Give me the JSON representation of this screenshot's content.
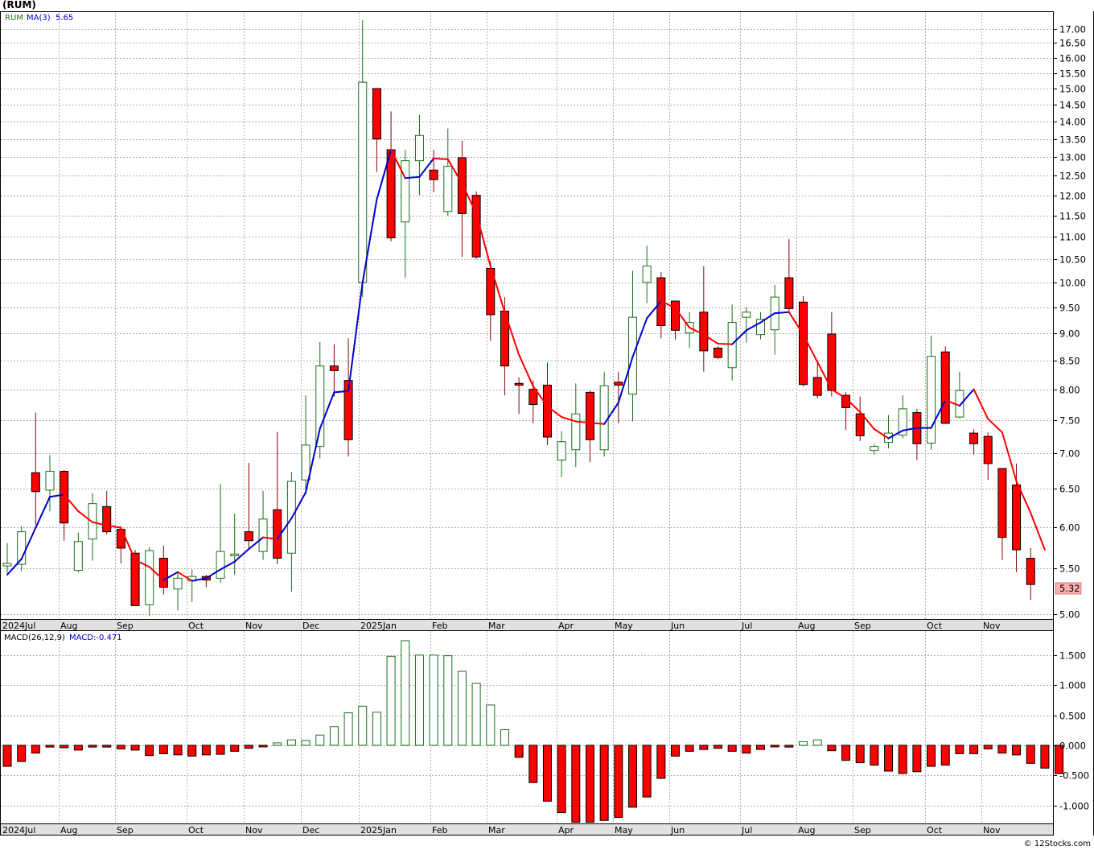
{
  "header": {
    "symbol_title": "(RUM)",
    "legend_symbol": "RUM",
    "legend_ma_label": "MA(3)",
    "legend_ma_value": "5.65"
  },
  "macd_header": {
    "label": "MACD(26,12,9)",
    "value_label": "MACD:-0.471"
  },
  "last_price_label": "5.32",
  "footer": {
    "credit": "© 12Stocks.com"
  },
  "colors": {
    "up_candle_stroke": "#1a6e1a",
    "down_candle_fill": "#ff0000",
    "ma_up": "#0000cc",
    "ma_down": "#ff0000",
    "macd_pos_stroke": "#1a6e1a",
    "macd_neg_fill": "#ff0000",
    "grid": "#b0b0b0",
    "price_tag_bg": "#ffb0b0"
  },
  "chart_data": [
    {
      "type": "candlestick",
      "title": "(RUM)",
      "x_tick_labels": [
        "2024Jul",
        "Aug",
        "Sep",
        "Oct",
        "Nov",
        "Dec",
        "2025Jan",
        "Feb",
        "Mar",
        "Apr",
        "May",
        "Jun",
        "Jul",
        "Aug",
        "Sep",
        "Oct",
        "Nov"
      ],
      "y_tick_labels": [
        "17.00",
        "16.50",
        "16.00",
        "15.50",
        "15.00",
        "14.50",
        "14.00",
        "13.50",
        "13.00",
        "12.50",
        "12.00",
        "11.50",
        "11.00",
        "10.50",
        "10.00",
        "9.50",
        "9.00",
        "8.50",
        "8.00",
        "7.50",
        "7.00",
        "6.50",
        "6.00",
        "5.50",
        "5.00"
      ],
      "y_ticks": [
        17.0,
        16.5,
        16.0,
        15.5,
        15.0,
        14.5,
        14.0,
        13.5,
        13.0,
        12.5,
        12.0,
        11.5,
        11.0,
        10.5,
        10.0,
        9.5,
        9.0,
        8.5,
        8.0,
        7.5,
        7.0,
        6.5,
        6.0,
        5.5,
        5.0
      ],
      "y_scale": "log",
      "ylim": [
        4.95,
        17.6
      ],
      "grid": true,
      "candles": [
        {
          "o": 5.53,
          "h": 5.8,
          "l": 5.45,
          "c": 5.56
        },
        {
          "o": 5.55,
          "h": 6.01,
          "l": 5.47,
          "c": 5.94
        },
        {
          "o": 6.72,
          "h": 7.62,
          "l": 6.03,
          "c": 6.46
        },
        {
          "o": 6.48,
          "h": 6.97,
          "l": 6.2,
          "c": 6.74
        },
        {
          "o": 6.74,
          "h": 6.76,
          "l": 5.83,
          "c": 6.05
        },
        {
          "o": 5.48,
          "h": 5.93,
          "l": 5.46,
          "c": 5.82
        },
        {
          "o": 5.85,
          "h": 6.44,
          "l": 5.59,
          "c": 6.3
        },
        {
          "o": 6.26,
          "h": 6.47,
          "l": 5.91,
          "c": 5.94
        },
        {
          "o": 5.97,
          "h": 6.01,
          "l": 5.56,
          "c": 5.74
        },
        {
          "o": 5.68,
          "h": 5.72,
          "l": 5.09,
          "c": 5.09
        },
        {
          "o": 5.1,
          "h": 5.75,
          "l": 4.98,
          "c": 5.71
        },
        {
          "o": 5.62,
          "h": 5.77,
          "l": 5.21,
          "c": 5.29
        },
        {
          "o": 5.27,
          "h": 5.47,
          "l": 5.04,
          "c": 5.39
        },
        {
          "o": 5.36,
          "h": 5.49,
          "l": 5.13,
          "c": 5.41
        },
        {
          "o": 5.41,
          "h": 5.43,
          "l": 5.29,
          "c": 5.37
        },
        {
          "o": 5.39,
          "h": 6.56,
          "l": 5.34,
          "c": 5.7
        },
        {
          "o": 5.65,
          "h": 6.17,
          "l": 5.43,
          "c": 5.67
        },
        {
          "o": 5.94,
          "h": 6.86,
          "l": 5.72,
          "c": 5.83
        },
        {
          "o": 5.7,
          "h": 6.47,
          "l": 5.6,
          "c": 6.1
        },
        {
          "o": 6.22,
          "h": 7.32,
          "l": 5.55,
          "c": 5.62
        },
        {
          "o": 5.68,
          "h": 6.73,
          "l": 5.24,
          "c": 6.6
        },
        {
          "o": 6.62,
          "h": 7.9,
          "l": 6.42,
          "c": 7.12
        },
        {
          "o": 7.1,
          "h": 8.83,
          "l": 6.92,
          "c": 8.4
        },
        {
          "o": 8.4,
          "h": 8.79,
          "l": 7.88,
          "c": 8.32
        },
        {
          "o": 8.15,
          "h": 8.9,
          "l": 6.95,
          "c": 7.2
        },
        {
          "o": 10.0,
          "h": 17.3,
          "l": 9.7,
          "c": 15.2
        },
        {
          "o": 15.0,
          "h": 15.0,
          "l": 12.6,
          "c": 13.5
        },
        {
          "o": 13.2,
          "h": 14.3,
          "l": 10.9,
          "c": 10.98
        },
        {
          "o": 11.35,
          "h": 13.2,
          "l": 10.1,
          "c": 12.9
        },
        {
          "o": 12.9,
          "h": 14.2,
          "l": 12.0,
          "c": 13.6
        },
        {
          "o": 12.65,
          "h": 13.2,
          "l": 12.08,
          "c": 12.4
        },
        {
          "o": 11.6,
          "h": 13.8,
          "l": 11.5,
          "c": 12.75
        },
        {
          "o": 12.98,
          "h": 13.45,
          "l": 10.55,
          "c": 11.55
        },
        {
          "o": 12.0,
          "h": 12.1,
          "l": 10.5,
          "c": 10.55
        },
        {
          "o": 10.3,
          "h": 10.45,
          "l": 8.85,
          "c": 9.35
        },
        {
          "o": 9.42,
          "h": 9.7,
          "l": 7.9,
          "c": 8.4
        },
        {
          "o": 8.1,
          "h": 8.2,
          "l": 7.6,
          "c": 8.07
        },
        {
          "o": 8.0,
          "h": 8.15,
          "l": 7.45,
          "c": 7.75
        },
        {
          "o": 8.07,
          "h": 8.46,
          "l": 7.12,
          "c": 7.24
        },
        {
          "o": 6.9,
          "h": 7.33,
          "l": 6.66,
          "c": 7.17
        },
        {
          "o": 7.05,
          "h": 8.1,
          "l": 6.8,
          "c": 7.6
        },
        {
          "o": 7.95,
          "h": 7.98,
          "l": 6.87,
          "c": 7.2
        },
        {
          "o": 7.05,
          "h": 8.3,
          "l": 6.95,
          "c": 8.06
        },
        {
          "o": 8.12,
          "h": 8.3,
          "l": 7.45,
          "c": 8.07
        },
        {
          "o": 7.92,
          "h": 10.25,
          "l": 7.48,
          "c": 9.3
        },
        {
          "o": 10.0,
          "h": 10.8,
          "l": 9.58,
          "c": 10.35
        },
        {
          "o": 10.1,
          "h": 10.22,
          "l": 8.9,
          "c": 9.14
        },
        {
          "o": 9.62,
          "h": 9.62,
          "l": 8.88,
          "c": 9.05
        },
        {
          "o": 9.0,
          "h": 9.4,
          "l": 8.72,
          "c": 9.2
        },
        {
          "o": 9.4,
          "h": 10.35,
          "l": 8.3,
          "c": 8.67
        },
        {
          "o": 8.72,
          "h": 8.75,
          "l": 8.52,
          "c": 8.55
        },
        {
          "o": 8.37,
          "h": 9.55,
          "l": 8.15,
          "c": 9.2
        },
        {
          "o": 9.3,
          "h": 9.5,
          "l": 8.82,
          "c": 9.4
        },
        {
          "o": 8.97,
          "h": 9.4,
          "l": 8.88,
          "c": 9.26
        },
        {
          "o": 9.06,
          "h": 9.95,
          "l": 8.6,
          "c": 9.7
        },
        {
          "o": 10.1,
          "h": 10.95,
          "l": 9.4,
          "c": 9.47
        },
        {
          "o": 9.6,
          "h": 9.72,
          "l": 8.05,
          "c": 8.08
        },
        {
          "o": 8.2,
          "h": 8.5,
          "l": 7.85,
          "c": 7.9
        },
        {
          "o": 8.98,
          "h": 9.4,
          "l": 7.88,
          "c": 7.98
        },
        {
          "o": 7.9,
          "h": 7.95,
          "l": 7.35,
          "c": 7.7
        },
        {
          "o": 7.6,
          "h": 7.88,
          "l": 7.18,
          "c": 7.26
        },
        {
          "o": 7.04,
          "h": 7.14,
          "l": 6.98,
          "c": 7.1
        },
        {
          "o": 7.16,
          "h": 7.58,
          "l": 7.07,
          "c": 7.3
        },
        {
          "o": 7.27,
          "h": 7.9,
          "l": 7.22,
          "c": 7.68
        },
        {
          "o": 7.62,
          "h": 7.68,
          "l": 6.9,
          "c": 7.14
        },
        {
          "o": 7.15,
          "h": 8.95,
          "l": 7.05,
          "c": 8.57
        },
        {
          "o": 8.65,
          "h": 8.75,
          "l": 7.45,
          "c": 7.45
        },
        {
          "o": 7.55,
          "h": 8.3,
          "l": 7.53,
          "c": 7.98
        },
        {
          "o": 7.3,
          "h": 7.36,
          "l": 6.98,
          "c": 7.14
        },
        {
          "o": 7.25,
          "h": 7.31,
          "l": 6.62,
          "c": 6.85
        },
        {
          "o": 6.78,
          "h": 6.78,
          "l": 5.6,
          "c": 5.87
        },
        {
          "o": 6.55,
          "h": 6.85,
          "l": 5.46,
          "c": 5.72
        },
        {
          "o": 5.62,
          "h": 5.74,
          "l": 5.15,
          "c": 5.32
        }
      ],
      "ma3": [
        5.43,
        5.61,
        5.99,
        6.39,
        6.42,
        6.2,
        6.06,
        6.02,
        5.99,
        5.6,
        5.52,
        5.37,
        5.46,
        5.36,
        5.39,
        5.49,
        5.58,
        5.73,
        5.87,
        5.85,
        6.11,
        6.45,
        7.37,
        7.95,
        7.97,
        10.0,
        11.9,
        13.2,
        12.44,
        12.47,
        12.96,
        12.94,
        12.3,
        11.55,
        10.35,
        9.4,
        8.6,
        8.05,
        7.72,
        7.55,
        7.48,
        7.46,
        7.44,
        7.78,
        8.56,
        9.28,
        9.62,
        9.48,
        9.1,
        8.97,
        8.8,
        8.79,
        9.05,
        9.2,
        9.38,
        9.4,
        8.97,
        8.47,
        8.0,
        7.85,
        7.63,
        7.36,
        7.22,
        7.34,
        7.38,
        7.38,
        7.82,
        7.73,
        8.0,
        7.52,
        7.31,
        6.6,
        6.18,
        5.72
      ],
      "last_price": 5.32
    },
    {
      "type": "bar",
      "title": "MACD(26,12,9)",
      "y_tick_labels": [
        "1.500",
        "1.000",
        "0.500",
        "0.000",
        "-0.500",
        "-1.000"
      ],
      "y_ticks": [
        1.5,
        1.0,
        0.5,
        0.0,
        -0.5,
        -1.0
      ],
      "ylim": [
        -1.3,
        1.9
      ],
      "grid": true,
      "values": [
        -0.35,
        -0.27,
        -0.13,
        -0.03,
        -0.04,
        -0.08,
        -0.03,
        -0.03,
        -0.06,
        -0.08,
        -0.17,
        -0.14,
        -0.16,
        -0.18,
        -0.16,
        -0.15,
        -0.1,
        -0.05,
        -0.02,
        0.04,
        0.09,
        0.08,
        0.17,
        0.31,
        0.54,
        0.65,
        0.55,
        1.48,
        1.74,
        1.5,
        1.5,
        1.49,
        1.23,
        1.03,
        0.67,
        0.26,
        -0.2,
        -0.62,
        -0.93,
        -1.12,
        -1.28,
        -1.28,
        -1.25,
        -1.2,
        -1.03,
        -0.86,
        -0.55,
        -0.18,
        -0.1,
        -0.07,
        -0.05,
        -0.1,
        -0.13,
        -0.07,
        -0.01,
        -0.03,
        0.06,
        0.09,
        -0.09,
        -0.25,
        -0.29,
        -0.33,
        -0.43,
        -0.47,
        -0.44,
        -0.35,
        -0.33,
        -0.14,
        -0.14,
        -0.06,
        -0.13,
        -0.16,
        -0.3,
        -0.38,
        -0.471
      ],
      "value": -0.471
    }
  ]
}
